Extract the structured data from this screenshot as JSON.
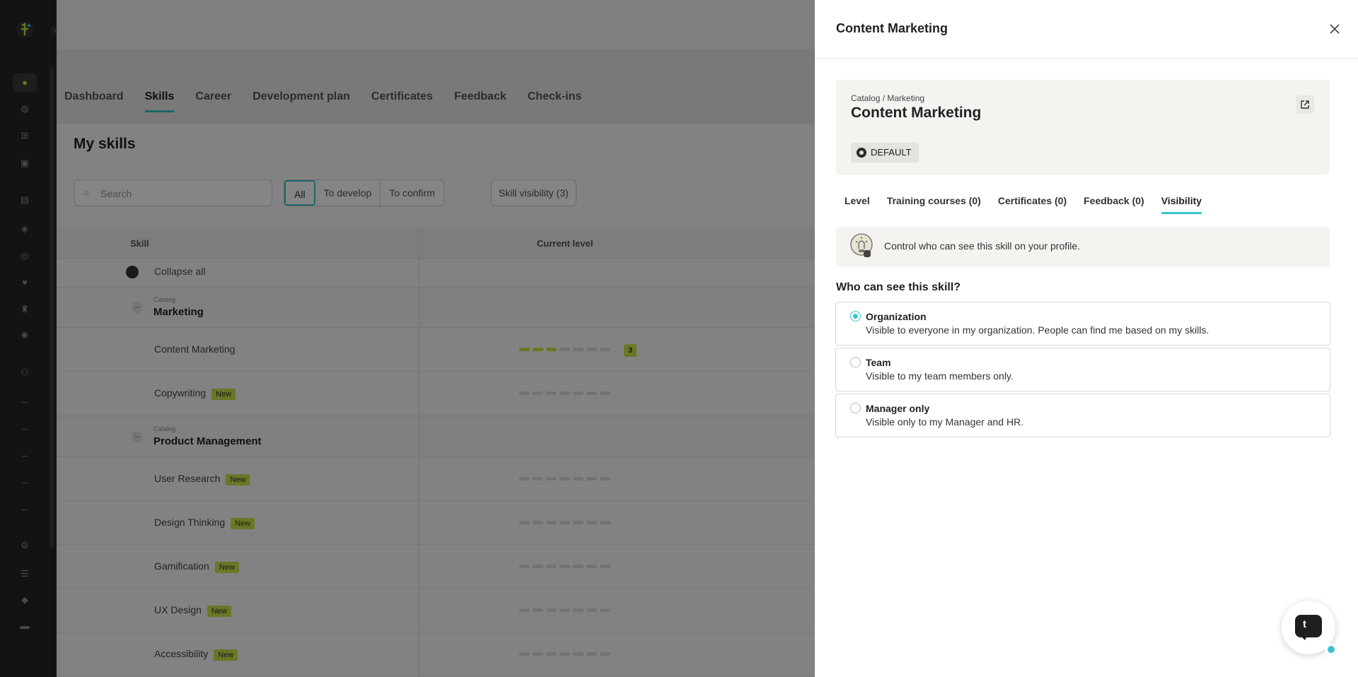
{
  "main_tabs": [
    {
      "label": "Dashboard"
    },
    {
      "label": "Skills"
    },
    {
      "label": "Career"
    },
    {
      "label": "Development plan"
    },
    {
      "label": "Certificates"
    },
    {
      "label": "Feedback"
    },
    {
      "label": "Check-ins"
    }
  ],
  "page": {
    "title": "My skills",
    "search_placeholder": "Search",
    "filters": [
      "All",
      "To develop",
      "To confirm"
    ],
    "visibility_button": "Skill visibility (3)",
    "columns": {
      "skill": "Skill",
      "current_level": "Current level"
    },
    "collapse_all": "Collapse all",
    "catalog_label": "Catalog",
    "new_badge": "New",
    "categories": [
      {
        "name": "Marketing",
        "skills": [
          {
            "name": "Content Marketing",
            "badge": "",
            "level": 3
          },
          {
            "name": "Copywriting",
            "badge": "New",
            "level": 0
          }
        ]
      },
      {
        "name": "Product Management",
        "skills": [
          {
            "name": "User Research",
            "badge": "New",
            "level": 0
          },
          {
            "name": "Design Thinking",
            "badge": "New",
            "level": 0
          },
          {
            "name": "Gamification",
            "badge": "New",
            "level": 0
          },
          {
            "name": "UX Design",
            "badge": "New",
            "level": 0
          },
          {
            "name": "Accessibility",
            "badge": "New",
            "level": 0
          }
        ]
      }
    ]
  },
  "drawer": {
    "title": "Content Marketing",
    "breadcrumb": "Catalog / Marketing",
    "skill_name": "Content Marketing",
    "tag": "DEFAULT",
    "tabs": [
      {
        "label": "Level"
      },
      {
        "label": "Training courses (0)"
      },
      {
        "label": "Certificates (0)"
      },
      {
        "label": "Feedback (0)"
      },
      {
        "label": "Visibility"
      }
    ],
    "active_tab": "Visibility",
    "info": "Control who can see this skill on your profile.",
    "question": "Who can see this skill?",
    "options": [
      {
        "title": "Organization",
        "desc": "Visible to everyone in my organization. People can find me based on my skills.",
        "selected": true
      },
      {
        "title": "Team",
        "desc": "Visible to my team members only.",
        "selected": false
      },
      {
        "title": "Manager only",
        "desc": "Visible only to my Manager and HR.",
        "selected": false
      }
    ]
  },
  "icons": {
    "close": "close-icon",
    "external": "external-link-icon",
    "chat": "chat-icon",
    "bulb": "lightbulb-icon"
  },
  "colors": {
    "accent": "#3bc4cf",
    "badge": "#c8e64a",
    "sidebar": "#262626"
  }
}
